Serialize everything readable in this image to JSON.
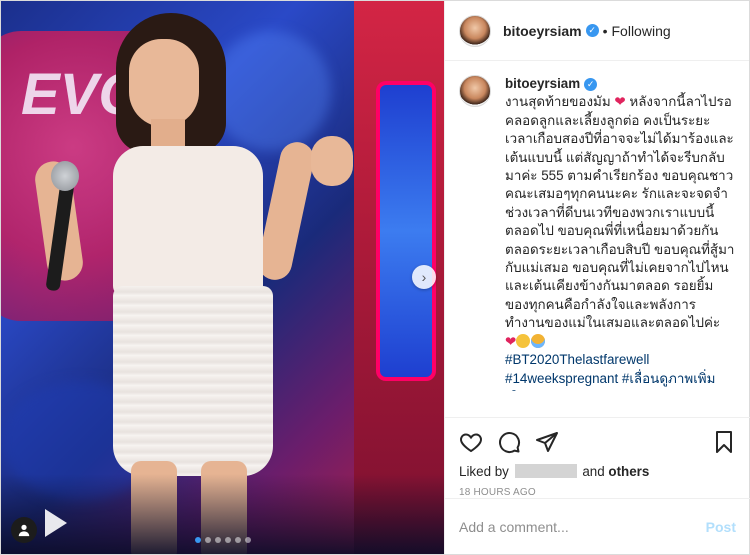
{
  "header": {
    "username": "bitoeyrsiam",
    "separator": "•",
    "follow_status": "Following"
  },
  "caption": {
    "username": "bitoeyrsiam",
    "text_before_heart": "งานสุดท้ายของมัม",
    "text_main": "หลังจากนี้ลาไปรอคลอดลูกและเลี้ยงลูกต่อ คงเป็นระยะเวลาเกือบสองปีที่อาจจะไม่ได้มาร้องและเต้นแบบนี้ แต่สัญญาถ้าทำได้จะรีบกลับมาค่ะ 555 ตามคำเรียกร้อง ขอบคุณชาวคณะเสมอๆทุกคนนะคะ รักและจะจดจำช่วงเวลาที่ดีบนเวทีของพวกเราแบบนี้ตลอดไป ขอบคุณพี่ที่เหนื่อยมาด้วยกันตลอดระยะเวลาเกือบสิบปี ขอบคุณที่สู้มากับแม่เสมอ ขอบคุณที่ไม่เคยจากไปไหนและเต้นเคียงข้างกันมาตลอด รอยยิ้มของทุกคนคือกำลังใจและพลังการทำงานของแม่ในเสมอและตลอดไปค่ะ",
    "hashtags": [
      "#BT2020Thelastfarewell",
      "#14weekspregnant",
      "#เลื่อนดูภาพเพิ่มเติม"
    ],
    "time": "18h"
  },
  "actions": {
    "liked_by_prefix": "Liked by",
    "liked_by_suffix": "and",
    "others": "others",
    "timestamp": "18 HOURS AGO"
  },
  "comment_box": {
    "placeholder": "Add a comment...",
    "post_label": "Post"
  },
  "media": {
    "carousel_total": 6,
    "carousel_active": 0
  },
  "colors": {
    "accent": "#3897f0",
    "hashtag": "#00376b",
    "heart": "#e0245e",
    "post_disabled": "#b2dffc"
  },
  "icons": {
    "like": "heart-outline-icon",
    "comment": "comment-bubble-icon",
    "share": "paper-plane-icon",
    "save": "bookmark-icon",
    "verified": "verified-badge-icon",
    "next": "chevron-right-icon",
    "tagged": "user-tag-icon"
  }
}
